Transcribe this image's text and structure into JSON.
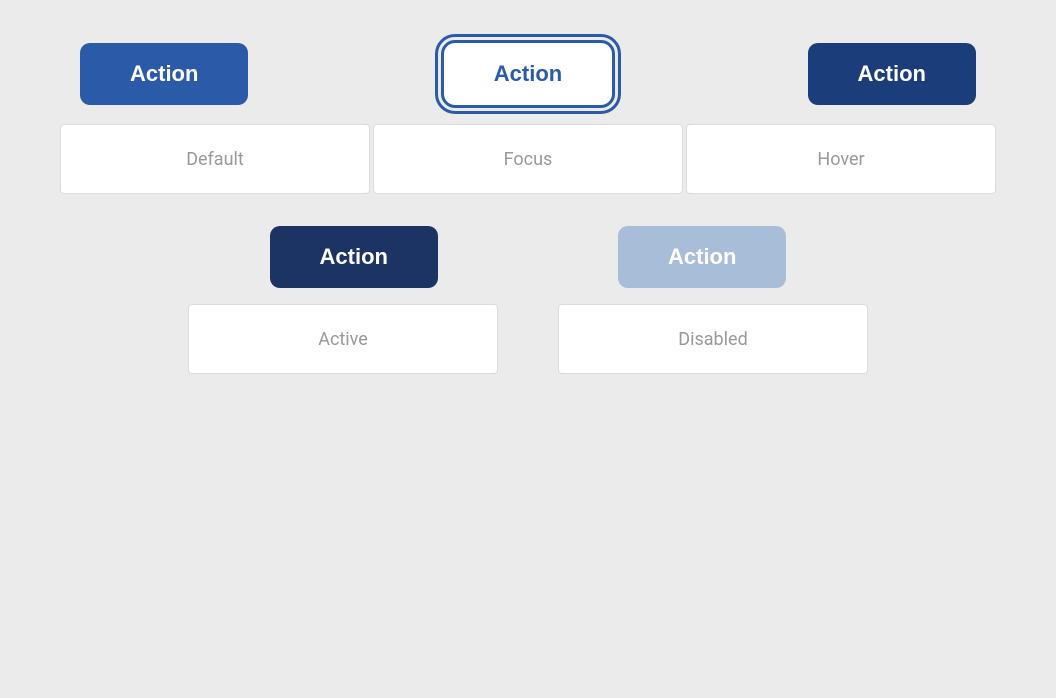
{
  "background_color": "#EBEBEB",
  "row1": {
    "buttons": [
      {
        "id": "default-button",
        "label": "Action",
        "state": "default",
        "style": "primary"
      },
      {
        "id": "focus-button",
        "label": "Action",
        "state": "focus",
        "style": "focus"
      },
      {
        "id": "hover-button",
        "label": "Action",
        "state": "hover",
        "style": "hover"
      }
    ],
    "labels": [
      {
        "id": "default-label",
        "text": "Default"
      },
      {
        "id": "focus-label",
        "text": "Focus"
      },
      {
        "id": "hover-label",
        "text": "Hover"
      }
    ]
  },
  "row2": {
    "buttons": [
      {
        "id": "active-button",
        "label": "Action",
        "state": "active",
        "style": "active"
      },
      {
        "id": "disabled-button",
        "label": "Action",
        "state": "disabled",
        "style": "disabled"
      }
    ],
    "labels": [
      {
        "id": "active-label",
        "text": "Active"
      },
      {
        "id": "disabled-label",
        "text": "Disabled"
      }
    ]
  }
}
